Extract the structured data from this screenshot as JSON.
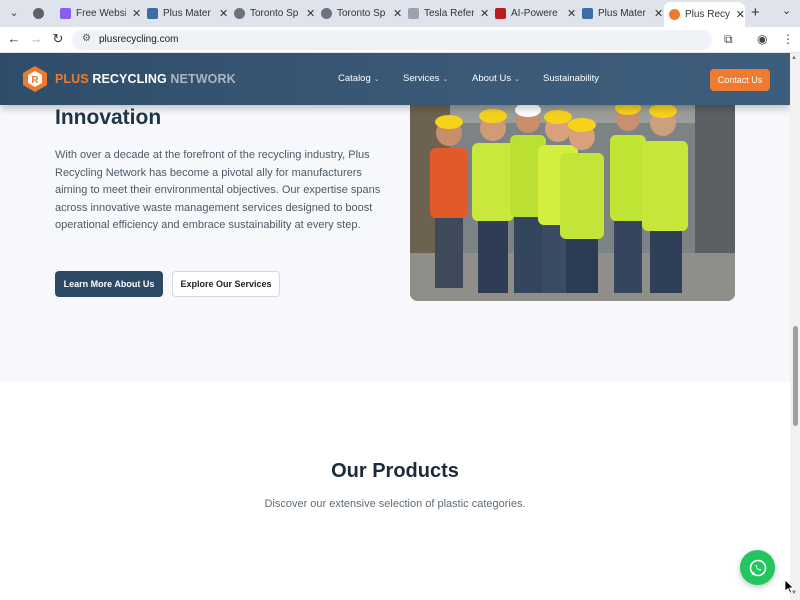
{
  "browser": {
    "tabs": [
      {
        "title": "",
        "favicon_color": "#5f6368"
      },
      {
        "title": "Free Websi",
        "favicon_color": "#8b5cf6"
      },
      {
        "title": "Plus Mater",
        "favicon_color": "#3b6ea8"
      },
      {
        "title": "Toronto Sp",
        "favicon_color": "#6b7280"
      },
      {
        "title": "Toronto Sp",
        "favicon_color": "#6b7280"
      },
      {
        "title": "Tesla Refer",
        "favicon_color": "#9ca3af"
      },
      {
        "title": "AI-Powere",
        "favicon_color": "#b91c1c"
      },
      {
        "title": "Plus Mater",
        "favicon_color": "#3b6ea8"
      },
      {
        "title": "Plus Recycl",
        "favicon_color": "#f07a2c"
      }
    ],
    "close_glyph": "✕",
    "new_tab": "+",
    "url": "plusrecycling.com"
  },
  "site": {
    "logo": {
      "word1": "PLUS",
      "word2": "RECYCLING",
      "word3": "NETWORK"
    },
    "nav": [
      {
        "label": "Catalog",
        "has_dropdown": true
      },
      {
        "label": "Services",
        "has_dropdown": true
      },
      {
        "label": "About Us",
        "has_dropdown": true
      },
      {
        "label": "Sustainability",
        "has_dropdown": false
      }
    ],
    "contact_label": "Contact Us",
    "hero": {
      "title_visible": "Innovation",
      "body": "With over a decade at the forefront of the recycling industry, Plus Recycling Network has become a pivotal ally for manufacturers aiming to meet their environmental objectives. Our expertise spans across innovative waste management services designed to boost operational efficiency and embrace sustainability at every step.",
      "primary_button": "Learn More About Us",
      "secondary_button": "Explore Our Services"
    },
    "products": {
      "title": "Our Products",
      "subtitle": "Discover our extensive selection of plastic categories."
    }
  },
  "colors": {
    "brand_orange": "#f07a2c",
    "header_navy": "#2e4d6a",
    "whatsapp_green": "#22c55e"
  }
}
